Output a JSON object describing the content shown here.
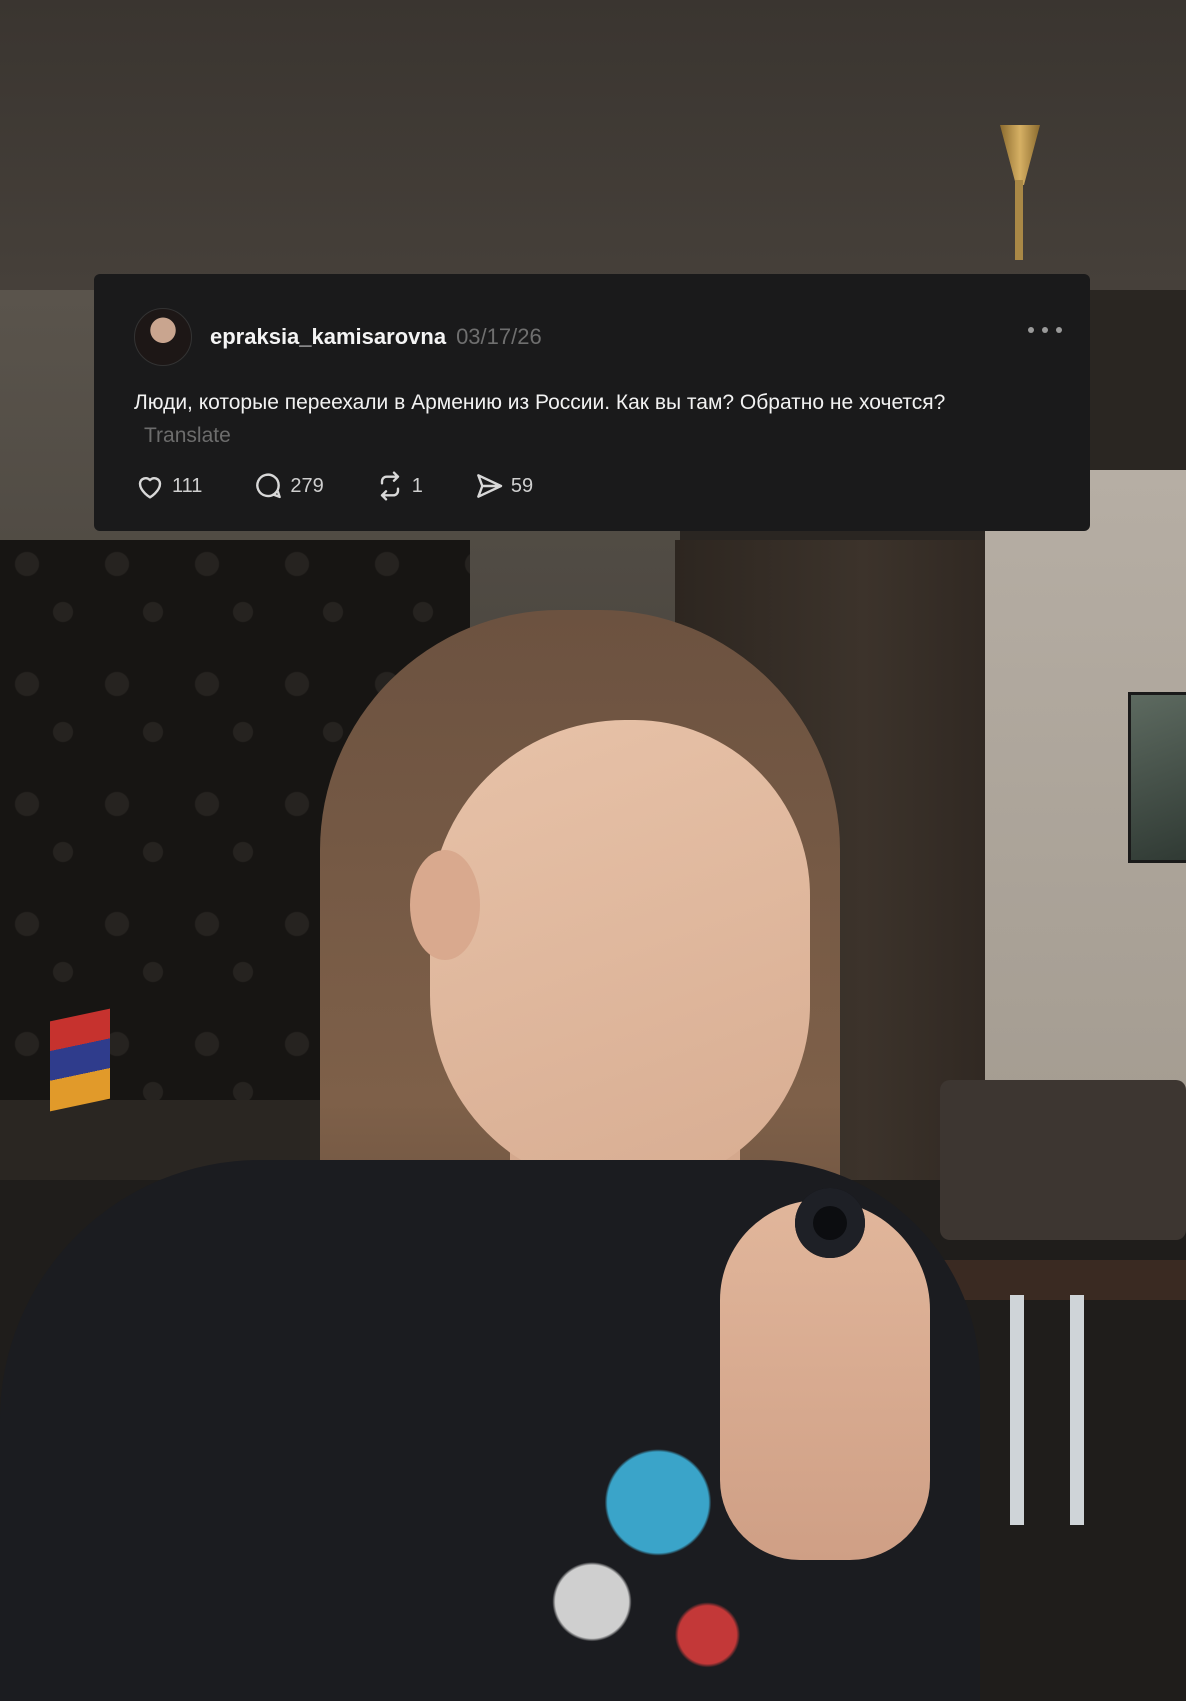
{
  "post": {
    "username": "epraksia_kamisarovna",
    "date": "03/17/26",
    "text": "Люди, которые переехали в Армению из России. Как вы там? Обратно не хочется?",
    "translate_label": "Translate",
    "stats": {
      "likes": "111",
      "replies": "279",
      "reposts": "1",
      "shares": "59"
    },
    "icons": {
      "like": "heart-icon",
      "reply": "comment-bubble-icon",
      "repost": "repost-arrows-icon",
      "share": "send-icon",
      "more": "more-horizontal-icon"
    }
  }
}
